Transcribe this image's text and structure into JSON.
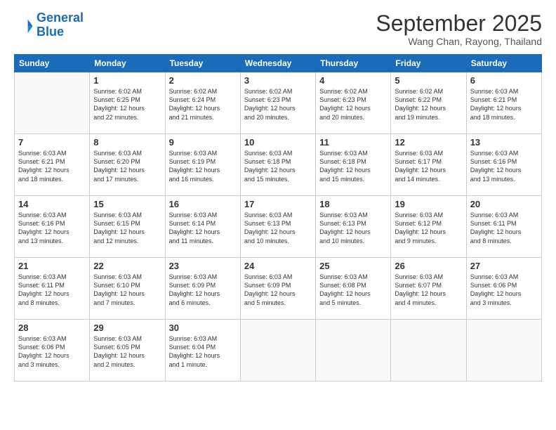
{
  "logo": {
    "line1": "General",
    "line2": "Blue"
  },
  "title": "September 2025",
  "subtitle": "Wang Chan, Rayong, Thailand",
  "header": {
    "days": [
      "Sunday",
      "Monday",
      "Tuesday",
      "Wednesday",
      "Thursday",
      "Friday",
      "Saturday"
    ]
  },
  "weeks": [
    [
      {
        "day": "",
        "info": ""
      },
      {
        "day": "1",
        "info": "Sunrise: 6:02 AM\nSunset: 6:25 PM\nDaylight: 12 hours\nand 22 minutes."
      },
      {
        "day": "2",
        "info": "Sunrise: 6:02 AM\nSunset: 6:24 PM\nDaylight: 12 hours\nand 21 minutes."
      },
      {
        "day": "3",
        "info": "Sunrise: 6:02 AM\nSunset: 6:23 PM\nDaylight: 12 hours\nand 20 minutes."
      },
      {
        "day": "4",
        "info": "Sunrise: 6:02 AM\nSunset: 6:23 PM\nDaylight: 12 hours\nand 20 minutes."
      },
      {
        "day": "5",
        "info": "Sunrise: 6:02 AM\nSunset: 6:22 PM\nDaylight: 12 hours\nand 19 minutes."
      },
      {
        "day": "6",
        "info": "Sunrise: 6:03 AM\nSunset: 6:21 PM\nDaylight: 12 hours\nand 18 minutes."
      }
    ],
    [
      {
        "day": "7",
        "info": "Sunrise: 6:03 AM\nSunset: 6:21 PM\nDaylight: 12 hours\nand 18 minutes."
      },
      {
        "day": "8",
        "info": "Sunrise: 6:03 AM\nSunset: 6:20 PM\nDaylight: 12 hours\nand 17 minutes."
      },
      {
        "day": "9",
        "info": "Sunrise: 6:03 AM\nSunset: 6:19 PM\nDaylight: 12 hours\nand 16 minutes."
      },
      {
        "day": "10",
        "info": "Sunrise: 6:03 AM\nSunset: 6:18 PM\nDaylight: 12 hours\nand 15 minutes."
      },
      {
        "day": "11",
        "info": "Sunrise: 6:03 AM\nSunset: 6:18 PM\nDaylight: 12 hours\nand 15 minutes."
      },
      {
        "day": "12",
        "info": "Sunrise: 6:03 AM\nSunset: 6:17 PM\nDaylight: 12 hours\nand 14 minutes."
      },
      {
        "day": "13",
        "info": "Sunrise: 6:03 AM\nSunset: 6:16 PM\nDaylight: 12 hours\nand 13 minutes."
      }
    ],
    [
      {
        "day": "14",
        "info": "Sunrise: 6:03 AM\nSunset: 6:16 PM\nDaylight: 12 hours\nand 13 minutes."
      },
      {
        "day": "15",
        "info": "Sunrise: 6:03 AM\nSunset: 6:15 PM\nDaylight: 12 hours\nand 12 minutes."
      },
      {
        "day": "16",
        "info": "Sunrise: 6:03 AM\nSunset: 6:14 PM\nDaylight: 12 hours\nand 11 minutes."
      },
      {
        "day": "17",
        "info": "Sunrise: 6:03 AM\nSunset: 6:13 PM\nDaylight: 12 hours\nand 10 minutes."
      },
      {
        "day": "18",
        "info": "Sunrise: 6:03 AM\nSunset: 6:13 PM\nDaylight: 12 hours\nand 10 minutes."
      },
      {
        "day": "19",
        "info": "Sunrise: 6:03 AM\nSunset: 6:12 PM\nDaylight: 12 hours\nand 9 minutes."
      },
      {
        "day": "20",
        "info": "Sunrise: 6:03 AM\nSunset: 6:11 PM\nDaylight: 12 hours\nand 8 minutes."
      }
    ],
    [
      {
        "day": "21",
        "info": "Sunrise: 6:03 AM\nSunset: 6:11 PM\nDaylight: 12 hours\nand 8 minutes."
      },
      {
        "day": "22",
        "info": "Sunrise: 6:03 AM\nSunset: 6:10 PM\nDaylight: 12 hours\nand 7 minutes."
      },
      {
        "day": "23",
        "info": "Sunrise: 6:03 AM\nSunset: 6:09 PM\nDaylight: 12 hours\nand 6 minutes."
      },
      {
        "day": "24",
        "info": "Sunrise: 6:03 AM\nSunset: 6:09 PM\nDaylight: 12 hours\nand 5 minutes."
      },
      {
        "day": "25",
        "info": "Sunrise: 6:03 AM\nSunset: 6:08 PM\nDaylight: 12 hours\nand 5 minutes."
      },
      {
        "day": "26",
        "info": "Sunrise: 6:03 AM\nSunset: 6:07 PM\nDaylight: 12 hours\nand 4 minutes."
      },
      {
        "day": "27",
        "info": "Sunrise: 6:03 AM\nSunset: 6:06 PM\nDaylight: 12 hours\nand 3 minutes."
      }
    ],
    [
      {
        "day": "28",
        "info": "Sunrise: 6:03 AM\nSunset: 6:06 PM\nDaylight: 12 hours\nand 3 minutes."
      },
      {
        "day": "29",
        "info": "Sunrise: 6:03 AM\nSunset: 6:05 PM\nDaylight: 12 hours\nand 2 minutes."
      },
      {
        "day": "30",
        "info": "Sunrise: 6:03 AM\nSunset: 6:04 PM\nDaylight: 12 hours\nand 1 minute."
      },
      {
        "day": "",
        "info": ""
      },
      {
        "day": "",
        "info": ""
      },
      {
        "day": "",
        "info": ""
      },
      {
        "day": "",
        "info": ""
      }
    ]
  ]
}
